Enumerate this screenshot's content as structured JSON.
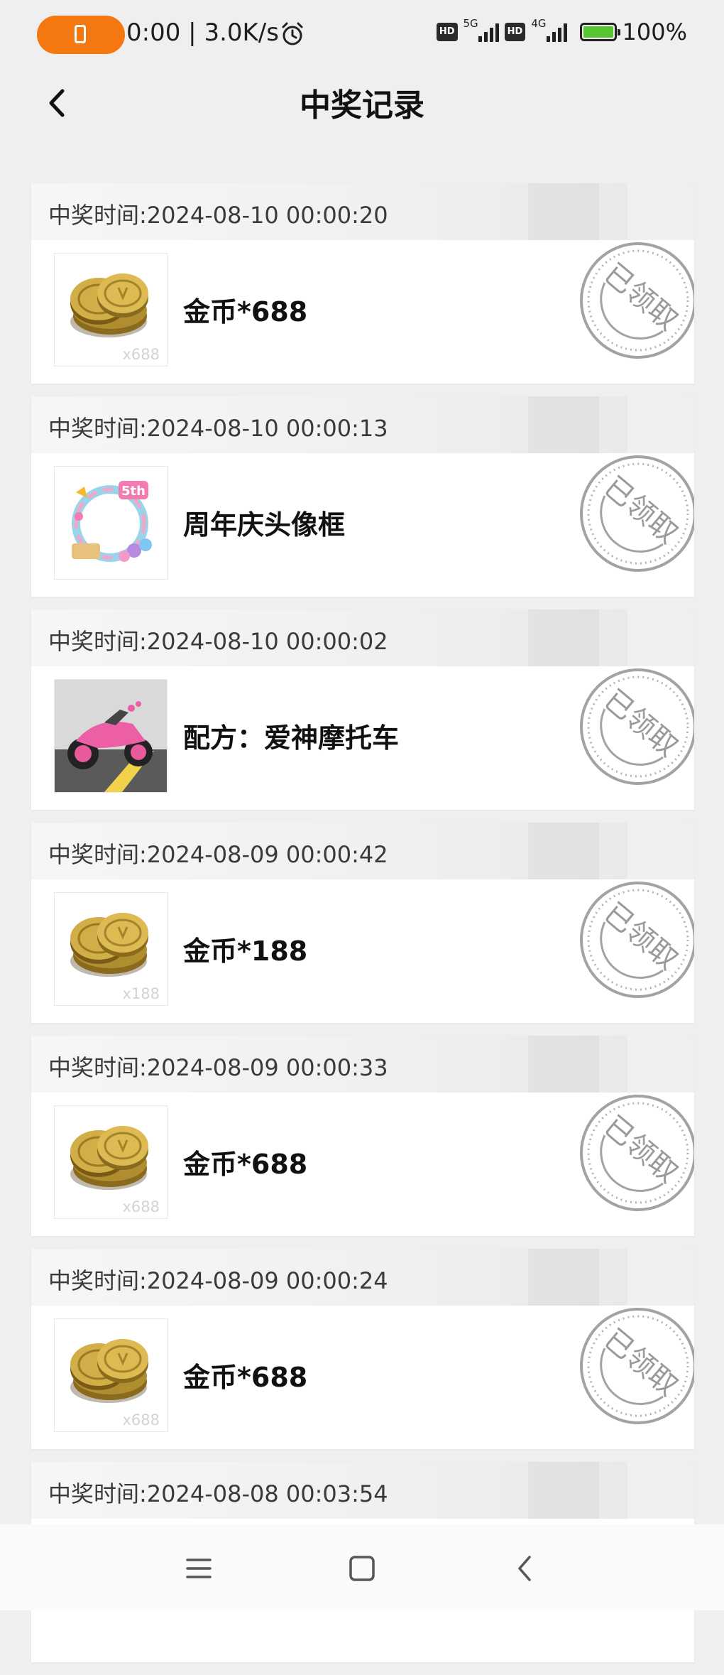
{
  "status_bar": {
    "time": "0:00",
    "net_speed": "3.0K/s",
    "hd_label": "HD",
    "network_1": "5G",
    "network_2": "4G",
    "battery": "100%",
    "app_indicator_color": "#f5770f"
  },
  "header": {
    "title": "中奖记录"
  },
  "records": [
    {
      "time": "中奖时间:2024-08-10 00:00:20",
      "prize": "金币*688",
      "thumb": "coins",
      "qty": "x688",
      "stamp": "已领取"
    },
    {
      "time": "中奖时间:2024-08-10 00:00:13",
      "prize": "周年庆头像框",
      "thumb": "avatar-frame",
      "qty": "",
      "stamp": "已领取"
    },
    {
      "time": "中奖时间:2024-08-10 00:00:02",
      "prize": "配方：爱神摩托车",
      "thumb": "motorcycle",
      "qty": "",
      "stamp": "已领取"
    },
    {
      "time": "中奖时间:2024-08-09 00:00:42",
      "prize": "金币*188",
      "thumb": "coins",
      "qty": "x188",
      "stamp": "已领取"
    },
    {
      "time": "中奖时间:2024-08-09 00:00:33",
      "prize": "金币*688",
      "thumb": "coins",
      "qty": "x688",
      "stamp": "已领取"
    },
    {
      "time": "中奖时间:2024-08-09 00:00:24",
      "prize": "金币*688",
      "thumb": "coins",
      "qty": "x688",
      "stamp": "已领取"
    },
    {
      "time": "中奖时间:2024-08-08 00:03:54",
      "prize": "",
      "thumb": "",
      "qty": "",
      "stamp": ""
    }
  ],
  "nav_icons": [
    "menu-icon",
    "home-icon",
    "back-icon"
  ]
}
